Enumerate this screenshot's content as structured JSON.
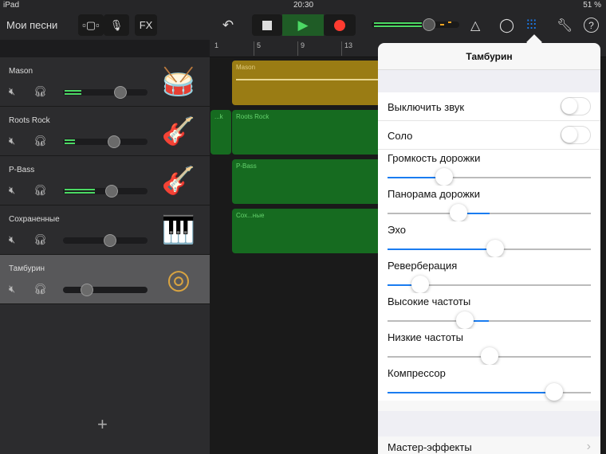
{
  "status": {
    "device": "iPad",
    "time": "20:30",
    "battery": "51 %"
  },
  "toolbar": {
    "my_songs": "Мои песни",
    "fx": "FX"
  },
  "ruler": [
    "1",
    "5",
    "9",
    "13"
  ],
  "tracks": [
    {
      "name": "Mason",
      "volume": 0.68,
      "level": 0.2,
      "instrument": "drums-icon"
    },
    {
      "name": "Roots Rock",
      "volume": 0.6,
      "level": 0.12,
      "instrument": "electric-guitar-icon"
    },
    {
      "name": "P-Bass",
      "volume": 0.58,
      "level": 0.36,
      "instrument": "bass-guitar-icon"
    },
    {
      "name": "Сохраненные",
      "volume": 0.56,
      "level": 0,
      "instrument": "keyboard-icon"
    },
    {
      "name": "Тамбурин",
      "volume": 0.28,
      "level": 0,
      "instrument": "tambourine-icon"
    }
  ],
  "regions": {
    "mason": "Mason",
    "roots_short": "...k",
    "roots": "Roots Rock",
    "pbass": "P-Bass",
    "saved": "Сох...ные"
  },
  "popover": {
    "title": "Тамбурин",
    "mute_label": "Выключить звук",
    "mute": false,
    "solo_label": "Соло",
    "solo": false,
    "sliders": [
      {
        "label": "Громкость дорожки",
        "value": 0.28,
        "from": 0
      },
      {
        "label": "Панорама дорожки",
        "value": 0.35,
        "from": 0.5
      },
      {
        "label": "Эхо",
        "value": 0.53,
        "from": 0
      },
      {
        "label": "Реверберация",
        "value": 0.16,
        "from": 0
      },
      {
        "label": "Высокие частоты",
        "value": 0.38,
        "from": 0.5
      },
      {
        "label": "Низкие частоты",
        "value": 0.5,
        "from": 0.5
      },
      {
        "label": "Компрессор",
        "value": 0.82,
        "from": 0
      }
    ],
    "master_effects": "Мастер-эффекты"
  },
  "colors": {
    "accent": "#1a7cf0",
    "green": "#4cd964",
    "record": "#ff3b30"
  }
}
